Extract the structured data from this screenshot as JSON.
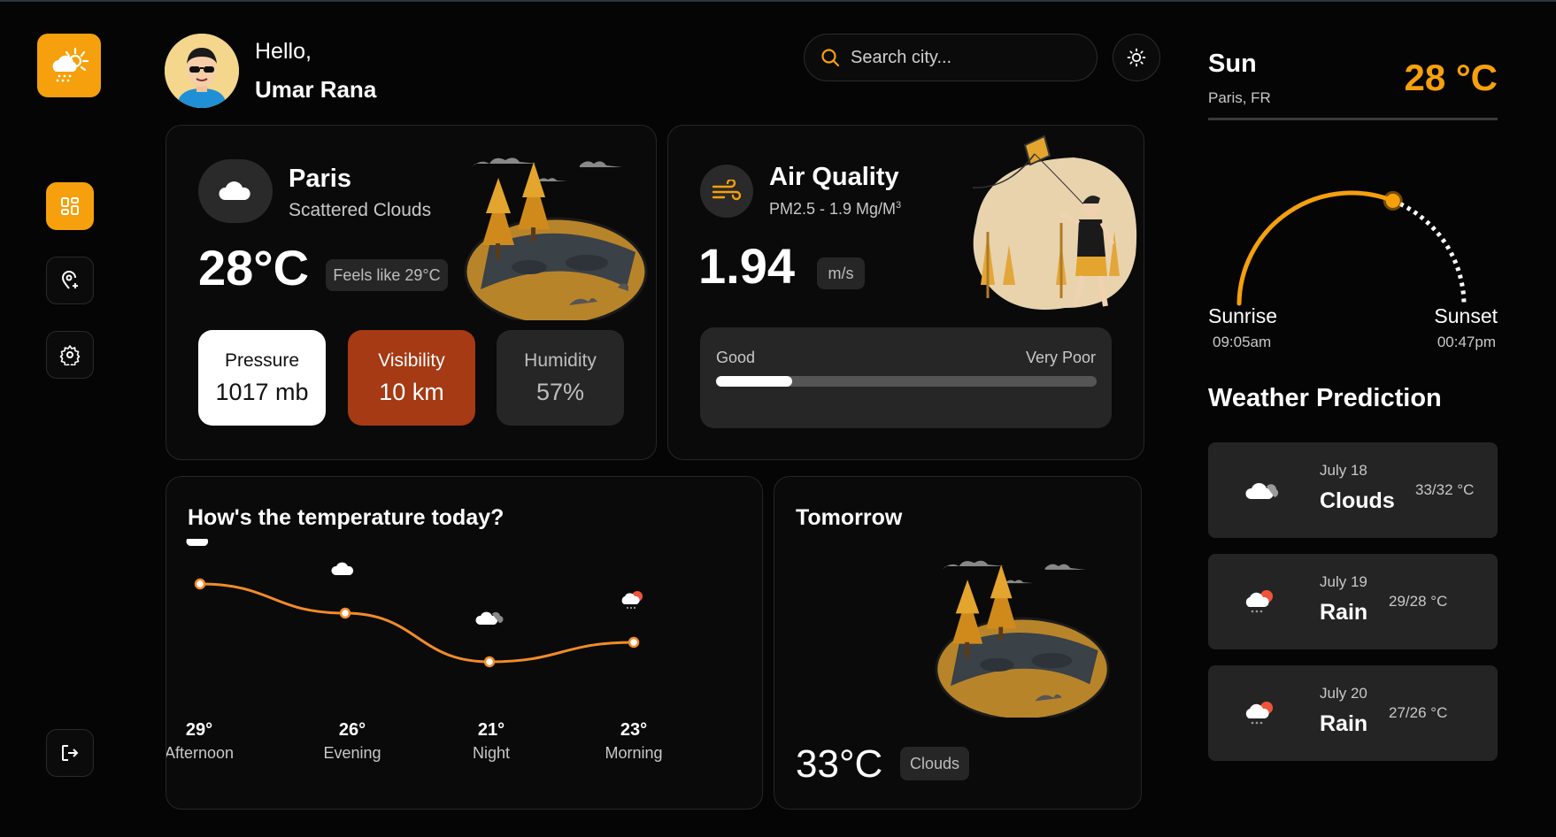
{
  "header": {
    "greeting": "Hello,",
    "user_name": "Umar Rana",
    "search_placeholder": "Search city..."
  },
  "current": {
    "city": "Paris",
    "condition": "Scattered Clouds",
    "temperature": "28°C",
    "feels_like": "Feels like 29°C",
    "stats": [
      {
        "label": "Pressure",
        "value": "1017 mb"
      },
      {
        "label": "Visibility",
        "value": "10 km"
      },
      {
        "label": "Humidity",
        "value": "57%"
      }
    ]
  },
  "air_quality": {
    "title": "Air Quality",
    "pm_label": "PM2.5 - 1.9 Mg/M",
    "pm_superscript": "3",
    "value": "1.94",
    "unit": "m/s",
    "scale_low": "Good",
    "scale_high": "Very Poor",
    "level_fraction": 0.2
  },
  "temperature_today": {
    "title": "How's the temperature today?"
  },
  "chart_data": {
    "type": "line",
    "categories": [
      "Afternoon",
      "Evening",
      "Night",
      "Morning"
    ],
    "values": [
      29,
      26,
      21,
      23
    ],
    "value_labels": [
      "29°",
      "26°",
      "21°",
      "23°"
    ],
    "icons": [
      "cloud-icon",
      "cloud-icon",
      "dark-cloud-icon",
      "sun-rain-icon"
    ],
    "title": "How's the temperature today?",
    "xlabel": "",
    "ylabel": "",
    "ylim": [
      20,
      30
    ],
    "grid": false,
    "color": "#f28c28"
  },
  "tomorrow": {
    "title": "Tomorrow",
    "temperature": "33°C",
    "condition": "Clouds"
  },
  "right_panel": {
    "day": "Sun",
    "location": "Paris, FR",
    "temperature": "28 °C",
    "sunrise_label": "Sunrise",
    "sunrise_time": "09:05am",
    "sunset_label": "Sunset",
    "sunset_time": "00:47pm",
    "sun_progress_fraction": 0.62,
    "prediction_title": "Weather Prediction",
    "predictions": [
      {
        "date": "July 18",
        "condition": "Clouds",
        "range": "33/32 °C",
        "icon": "cloud-icon"
      },
      {
        "date": "July 19",
        "condition": "Rain",
        "range": "29/28 °C",
        "icon": "sun-rain-icon"
      },
      {
        "date": "July 20",
        "condition": "Rain",
        "range": "27/26 °C",
        "icon": "sun-rain-icon"
      }
    ]
  },
  "colors": {
    "accent": "#f5a00c",
    "visibility_bg": "#a53a14",
    "card_bg": "#0a0a0a",
    "pill_bg": "#262626"
  }
}
